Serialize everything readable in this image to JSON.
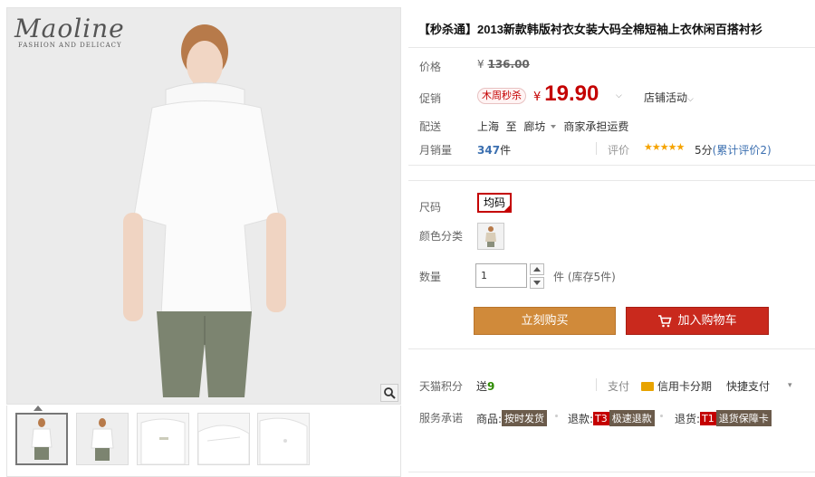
{
  "brand": {
    "name": "Maoline",
    "tagline": "FASHION AND DELICACY"
  },
  "product": {
    "title": "【秒杀通】2013新款韩版衬衣女装大码全棉短袖上衣休闲百搭衬衫"
  },
  "price": {
    "label": "价格",
    "currency": "¥",
    "original": "136.00"
  },
  "promo": {
    "label": "促销",
    "badge": "木周秒杀",
    "currency": "¥",
    "price": "19.90",
    "shop_promo": "店铺活动"
  },
  "shipping": {
    "label": "配送",
    "from": "上海",
    "to_word": "至",
    "to": "廊坊",
    "fee": "商家承担运费"
  },
  "sales": {
    "label": "月销量",
    "count": "347",
    "unit": "件",
    "rating_label": "评价",
    "stars": "★★★★★",
    "score": "5分",
    "reviews_prefix": "(累计评价",
    "reviews_count": "2",
    "reviews_suffix": ")"
  },
  "sku": {
    "size_label": "尺码",
    "size_value": "均码",
    "color_label": "颜色分类",
    "qty_label": "数量",
    "qty_value": "1",
    "stock_text": "件 (库存5件)"
  },
  "actions": {
    "buy_now": "立刻购买",
    "add_to_cart": "加入购物车"
  },
  "points": {
    "label": "天猫积分",
    "prefix": "送",
    "value": "9"
  },
  "payment": {
    "label": "支付",
    "credit": "信用卡分期",
    "quick": "快捷支付"
  },
  "service": {
    "label": "服务承诺",
    "goods_prefix": "商品:",
    "goods_tag": "按时发货",
    "refund_prefix": "退款:",
    "refund_id": "T3",
    "refund_tag": "极速退款",
    "return_prefix": "退货:",
    "return_id": "T1",
    "return_tag": "退货保障卡"
  },
  "colors": {
    "accent_red": "#c40000",
    "buy_button": "#d08a3a",
    "cart_button": "#c9291d",
    "link_blue": "#3b6fb0"
  }
}
